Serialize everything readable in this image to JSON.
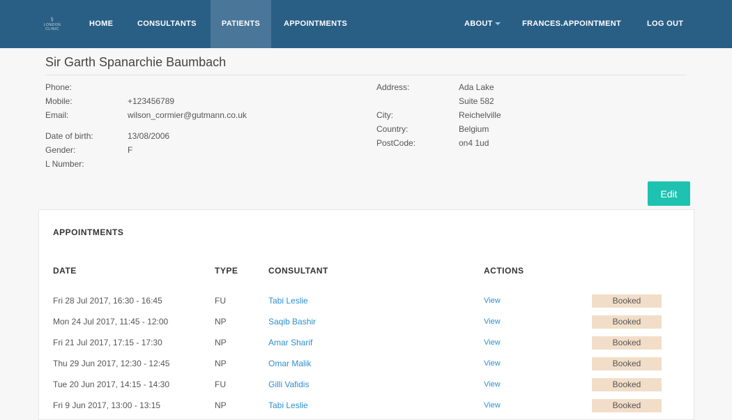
{
  "nav": {
    "logo_text": "LONDON CLINIC",
    "items": [
      {
        "label": "HOME"
      },
      {
        "label": "CONSULTANTS"
      },
      {
        "label": "PATIENTS"
      },
      {
        "label": "APPOINTMENTS"
      },
      {
        "label": "ABOUT"
      },
      {
        "label": "FRANCES.APPOINTMENT"
      },
      {
        "label": "LOG OUT"
      }
    ],
    "active": "PATIENTS",
    "colors": {
      "bar": "#2a5f85",
      "active": "#4a7699",
      "caret": "#8fd0f2"
    }
  },
  "patient": {
    "name": "Sir Garth Spanarchie Baumbach",
    "left": {
      "phone_label": "Phone:",
      "phone": "",
      "mobile_label": "Mobile:",
      "mobile": "+123456789",
      "email_label": "Email:",
      "email": "wilson_cormier@gutmann.co.uk",
      "dob_label": "Date of birth:",
      "dob": "13/08/2006",
      "gender_label": "Gender:",
      "gender": "F",
      "lnumber_label": "L Number:",
      "lnumber": ""
    },
    "right": {
      "address_label": "Address:",
      "address_line1": "Ada Lake",
      "address_line2": "Suite 582",
      "city_label": "City:",
      "city": "Reichelville",
      "country_label": "Country:",
      "country": "Belgium",
      "postcode_label": "PostCode:",
      "postcode": "on4 1ud"
    },
    "edit_label": "Edit"
  },
  "appointments": {
    "title": "APPOINTMENTS",
    "columns": {
      "date": "DATE",
      "type": "TYPE",
      "consultant": "CONSULTANT",
      "actions": "ACTIONS"
    },
    "rows": [
      {
        "date": "Fri 28 Jul 2017, 16:30 - 16:45",
        "type": "FU",
        "consultant": "Tabi Leslie",
        "action": "View",
        "status": "Booked"
      },
      {
        "date": "Mon 24 Jul 2017, 11:45 - 12:00",
        "type": "NP",
        "consultant": "Saqib Bashir",
        "action": "View",
        "status": "Booked"
      },
      {
        "date": "Fri 21 Jul 2017, 17:15 - 17:30",
        "type": "NP",
        "consultant": "Amar Sharif",
        "action": "View",
        "status": "Booked"
      },
      {
        "date": "Thu 29 Jun 2017, 12:30 - 12:45",
        "type": "NP",
        "consultant": "Omar Malik",
        "action": "View",
        "status": "Booked"
      },
      {
        "date": "Tue 20 Jun 2017, 14:15 - 14:30",
        "type": "FU",
        "consultant": "Gilli Vafidis",
        "action": "View",
        "status": "Booked"
      },
      {
        "date": "Fri 9 Jun 2017, 13:00 - 13:15",
        "type": "NP",
        "consultant": "Tabi Leslie",
        "action": "View",
        "status": "Booked"
      }
    ]
  },
  "colors": {
    "accent": "#1fc2b0",
    "link": "#2d8fd0",
    "badge_bg": "#f2dec8"
  }
}
